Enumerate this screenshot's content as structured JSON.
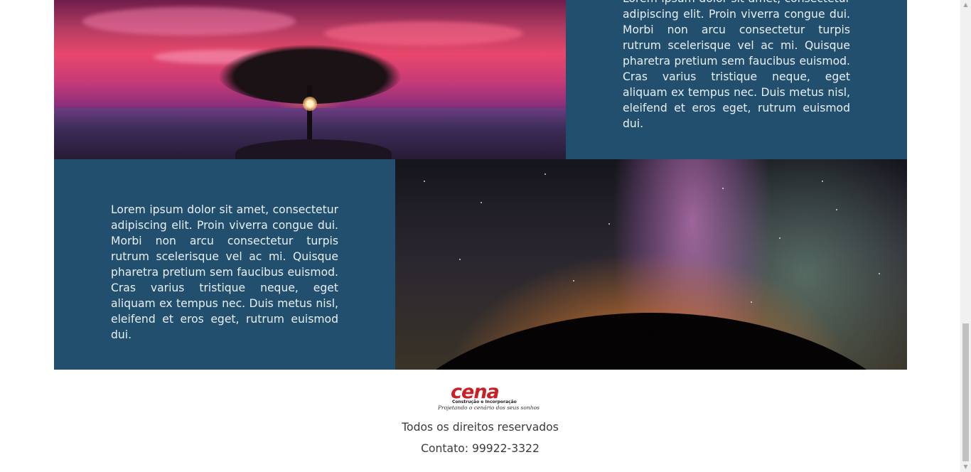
{
  "sections": [
    {
      "text": "Lorem ipsum dolor sit amet, consectetur adipiscing elit. Proin viverra congue dui. Morbi non arcu consectetur turpis rutrum scelerisque vel ac mi. Quisque pharetra pretium sem faucibus euismod. Cras varius tristique neque, eget aliquam ex tempus nec. Duis metus nisl, eleifend et eros eget, rutrum euismod dui.",
      "image": "sunset-tree-image"
    },
    {
      "text": "Lorem ipsum dolor sit amet, consectetur adipiscing elit. Proin viverra congue dui. Morbi non arcu consectetur turpis rutrum scelerisque vel ac mi. Quisque pharetra pretium sem faucibus euismod. Cras varius tristique neque, eget aliquam ex tempus nec. Duis metus nisl, eleifend et eros eget, rutrum euismod dui.",
      "image": "milky-way-image"
    }
  ],
  "footer": {
    "logo": {
      "wordmark": "cena",
      "subtitle": "Construção e Incorporação",
      "tagline": "Projetando o cenário dos seus sonhos"
    },
    "rights": "Todos os direitos reservados",
    "contact": "Contato: 99922-3322"
  },
  "colors": {
    "panel": "#224f6d",
    "brand_red": "#cc1e24",
    "footer_text": "#3b3b3b"
  }
}
